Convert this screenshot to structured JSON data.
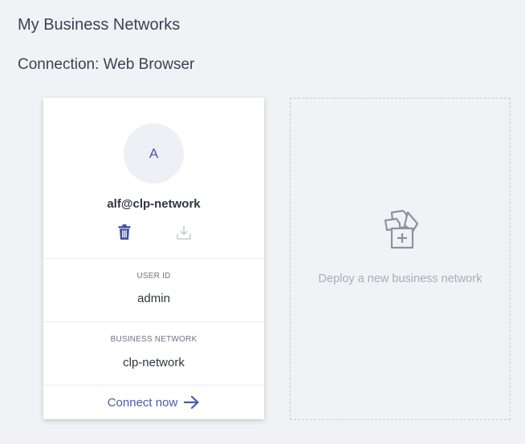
{
  "header": {
    "title": "My Business Networks",
    "connection": "Connection: Web Browser"
  },
  "card": {
    "avatar_initial": "A",
    "name": "alf@clp-network",
    "delete_icon": "trash-icon",
    "export_icon": "download-icon",
    "user_id_label": "USER ID",
    "user_id_value": "admin",
    "business_network_label": "BUSINESS NETWORK",
    "business_network_value": "clp-network",
    "connect_label": "Connect now",
    "connect_icon": "arrow-right-icon"
  },
  "deploy": {
    "label": "Deploy a new business network",
    "icon": "deploy-files-icon"
  },
  "colors": {
    "background": "#f1f2f6",
    "accent": "#4a5aa8",
    "muted": "#a9adb7",
    "avatar_bg": "#eef0f6"
  }
}
